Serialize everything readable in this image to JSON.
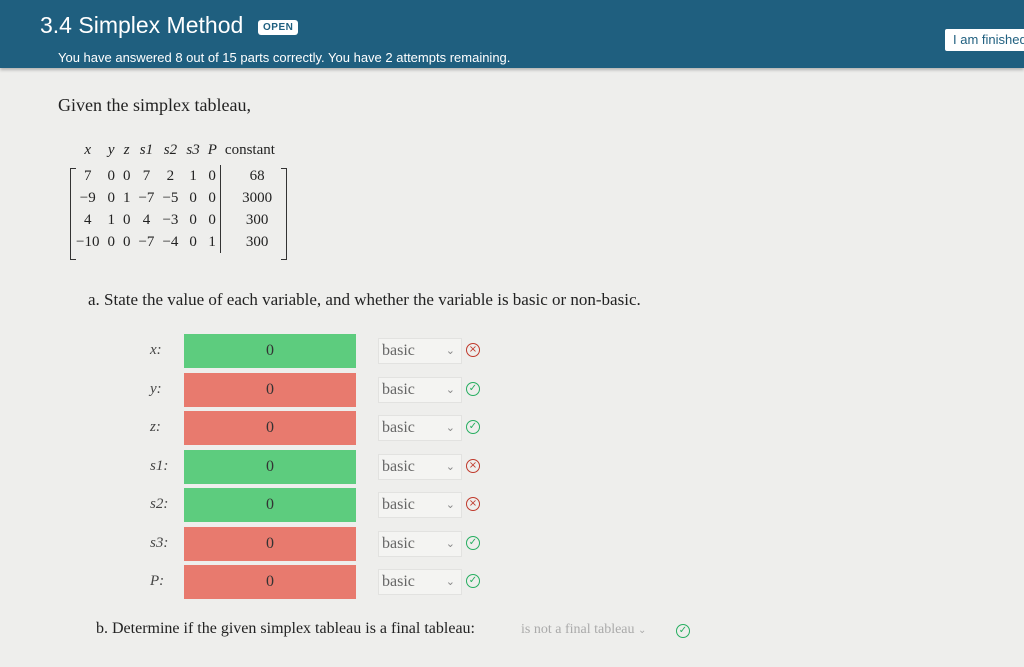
{
  "header": {
    "title": "3.4 Simplex Method",
    "badge": "OPEN",
    "progress": "You have answered 8 out of 15 parts correctly. You have 2 attempts remaining.",
    "finish_label": "I am finished"
  },
  "prompt": "Given the simplex tableau,",
  "tableau": {
    "headers": [
      "x",
      "y",
      "z",
      "s1",
      "s2",
      "s3",
      "P",
      "constant"
    ],
    "rows": [
      [
        "7",
        "0",
        "0",
        "7",
        "2",
        "1",
        "0",
        "68"
      ],
      [
        "−9",
        "0",
        "1",
        "−7",
        "−5",
        "0",
        "0",
        "3000"
      ],
      [
        "4",
        "1",
        "0",
        "4",
        "−3",
        "0",
        "0",
        "300"
      ],
      [
        "−10",
        "0",
        "0",
        "−7",
        "−4",
        "0",
        "1",
        "300"
      ]
    ]
  },
  "part_a": "a. State the value of each variable, and whether the variable is basic or non-basic.",
  "answers": [
    {
      "label": "x:",
      "value": "0",
      "selected": "basic",
      "field_color": "#5dcc7e",
      "status": "wrong",
      "status_icon": "×"
    },
    {
      "label": "y:",
      "value": "0",
      "selected": "basic",
      "field_color": "#e87a6e",
      "status": "right",
      "status_icon": "✓"
    },
    {
      "label": "z:",
      "value": "0",
      "selected": "basic",
      "field_color": "#e87a6e",
      "status": "right",
      "status_icon": "✓"
    },
    {
      "label": "s1:",
      "value": "0",
      "selected": "basic",
      "field_color": "#5dcc7e",
      "status": "wrong",
      "status_icon": "×"
    },
    {
      "label": "s2:",
      "value": "0",
      "selected": "basic",
      "field_color": "#5dcc7e",
      "status": "wrong",
      "status_icon": "×"
    },
    {
      "label": "s3:",
      "value": "0",
      "selected": "basic",
      "field_color": "#e87a6e",
      "status": "right",
      "status_icon": "✓"
    },
    {
      "label": "P:",
      "value": "0",
      "selected": "basic",
      "field_color": "#e87a6e",
      "status": "right",
      "status_icon": "✓"
    }
  ],
  "part_b": "b. Determine if the given simplex tableau is a final tableau:",
  "final_select": "is not a final tableau",
  "final_status_icon": "✓",
  "colors": {
    "header_bg": "#1f5f7f",
    "correct_green": "#27ae60",
    "wrong_red": "#c0392b"
  }
}
